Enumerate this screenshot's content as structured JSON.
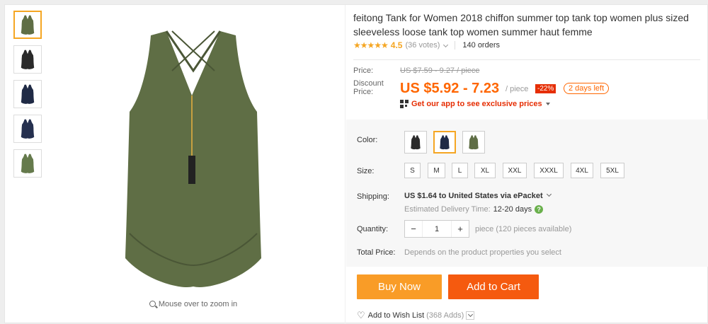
{
  "product": {
    "title": "feitong Tank for Women 2018 chiffon summer top tank top women plus sized sleeveless loose tank top women summer haut femme",
    "stars": "★★★★★",
    "rating": "4.5",
    "votes": "(36 votes)",
    "orders": "140 orders"
  },
  "gallery": {
    "zoom_hint": "Mouse over to zoom in",
    "thumb_colors": [
      "#5f6e45",
      "#2a2a2a",
      "#1f2a45",
      "#25304f",
      "#657a4c"
    ],
    "main_color": "#5f6e45"
  },
  "price": {
    "price_label": "Price:",
    "original": "US $7.59 - 9.27 / piece",
    "discount_label": "Discount Price:",
    "current": "US $5.92 - 7.23",
    "unit": "/ piece",
    "off": "-22%",
    "days_left": "2 days left",
    "app_promo": "Get our app to see exclusive prices"
  },
  "options": {
    "color_label": "Color:",
    "colors": [
      "#2a2a2a",
      "#1f2a45",
      "#5f6e45"
    ],
    "size_label": "Size:",
    "sizes": [
      "S",
      "M",
      "L",
      "XL",
      "XXL",
      "XXXL",
      "4XL",
      "5XL"
    ]
  },
  "shipping": {
    "label": "Shipping:",
    "value": "US $1.64 to United States via ePacket",
    "delivery_label": "Estimated Delivery Time:",
    "delivery_days": "12-20 days"
  },
  "quantity": {
    "label": "Quantity:",
    "minus": "−",
    "value": "1",
    "plus": "+",
    "available": "piece (120 pieces available)"
  },
  "total": {
    "label": "Total Price:",
    "value": "Depends on the product properties you select"
  },
  "actions": {
    "buy_now": "Buy Now",
    "add_to_cart": "Add to Cart",
    "wish_label": "Add to Wish List",
    "wish_adds": "(368 Adds)"
  }
}
